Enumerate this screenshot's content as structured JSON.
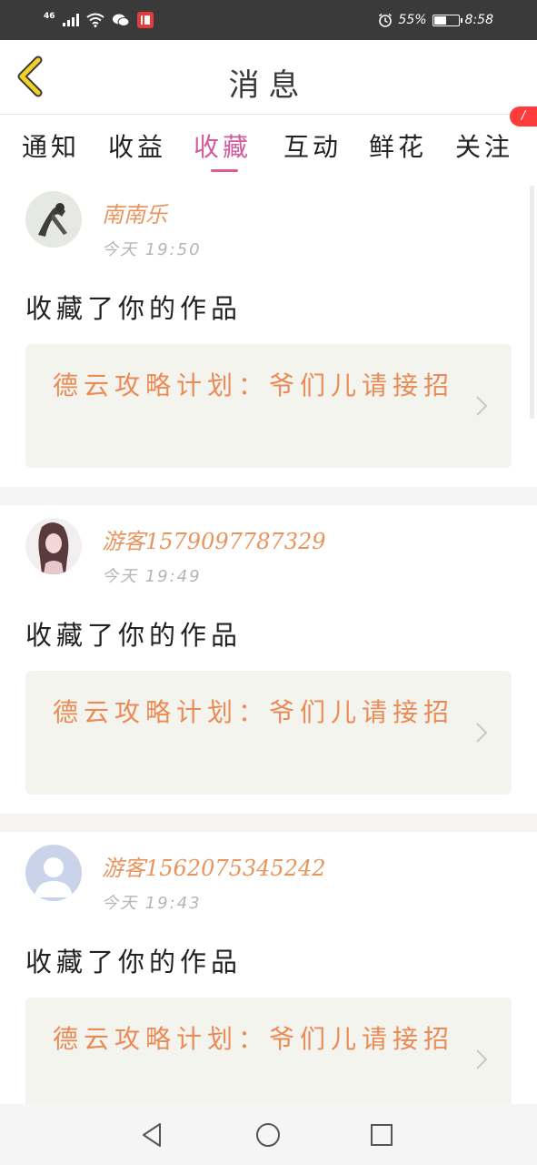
{
  "status_bar": {
    "network": "46",
    "battery_text": "55%",
    "battery_level": 0.55,
    "time": "8:58"
  },
  "header": {
    "title": "消息"
  },
  "tabs": [
    {
      "label": "通知"
    },
    {
      "label": "收益"
    },
    {
      "label": "收藏"
    },
    {
      "label": "互动"
    },
    {
      "label": "鲜花"
    },
    {
      "label": "关注"
    }
  ],
  "active_tab": "收藏",
  "tab_badge": "/",
  "notifications": [
    {
      "user": "南南乐",
      "time": "今天 19:50",
      "action": "收藏了你的作品",
      "work_title": "德云攻略计划：爷们儿请接招"
    },
    {
      "user": "游客1579097787329",
      "time": "今天 19:49",
      "action": "收藏了你的作品",
      "work_title": "德云攻略计划：爷们儿请接招"
    },
    {
      "user": "游客1562075345242",
      "time": "今天 19:43",
      "action": "收藏了你的作品",
      "work_title": "德云攻略计划：爷们儿请接招"
    }
  ],
  "icons": {
    "back": "chevron-left-icon",
    "arrow": "chevron-right-icon",
    "nav_back": "triangle-back-icon",
    "nav_home": "circle-home-icon",
    "nav_recent": "square-recent-icon"
  },
  "colors": {
    "accent_pink": "#e0589a",
    "username_orange": "#e8955d",
    "work_orange": "#ea8a56",
    "back_arrow": "#f2d028"
  }
}
